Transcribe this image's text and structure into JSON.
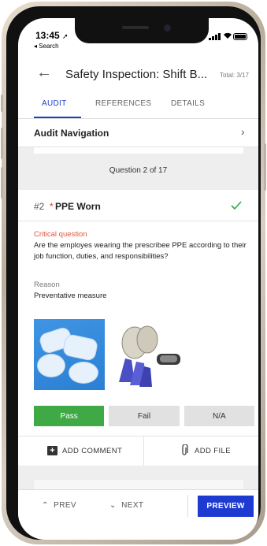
{
  "status_bar": {
    "time": "13:45",
    "location_glyph": "➚",
    "back_app": "◂ Search"
  },
  "header": {
    "title": "Safety Inspection: Shift B...",
    "total": "Total: 3/17"
  },
  "tabs": [
    {
      "label": "AUDIT",
      "active": true
    },
    {
      "label": "REFERENCES",
      "active": false
    },
    {
      "label": "DETAILS",
      "active": false
    }
  ],
  "audit_nav": {
    "label": "Audit Navigation"
  },
  "question_counter": "Question 2 of 17",
  "question": {
    "number": "#2",
    "required_mark": "*",
    "title": "PPE Worn",
    "critical_label": "Critical question",
    "text": "Are the employes wearing the prescribee PPE according to their job function, duties, and responsibilities?",
    "reason_label": "Reason",
    "reason_value": "Preventative measure"
  },
  "answer_options": [
    {
      "label": "Pass",
      "selected": true
    },
    {
      "label": "Fail",
      "selected": false
    },
    {
      "label": "N/A",
      "selected": false
    }
  ],
  "actions": {
    "add_comment": "ADD COMMENT",
    "add_file": "ADD FILE"
  },
  "footer": {
    "prev": "PREV",
    "next": "NEXT",
    "preview": "PREVIEW"
  },
  "colors": {
    "accent_blue": "#1e3fc8",
    "pass_green": "#3fa945",
    "critical_red": "#e2543a",
    "required_red": "#e03a3a"
  }
}
